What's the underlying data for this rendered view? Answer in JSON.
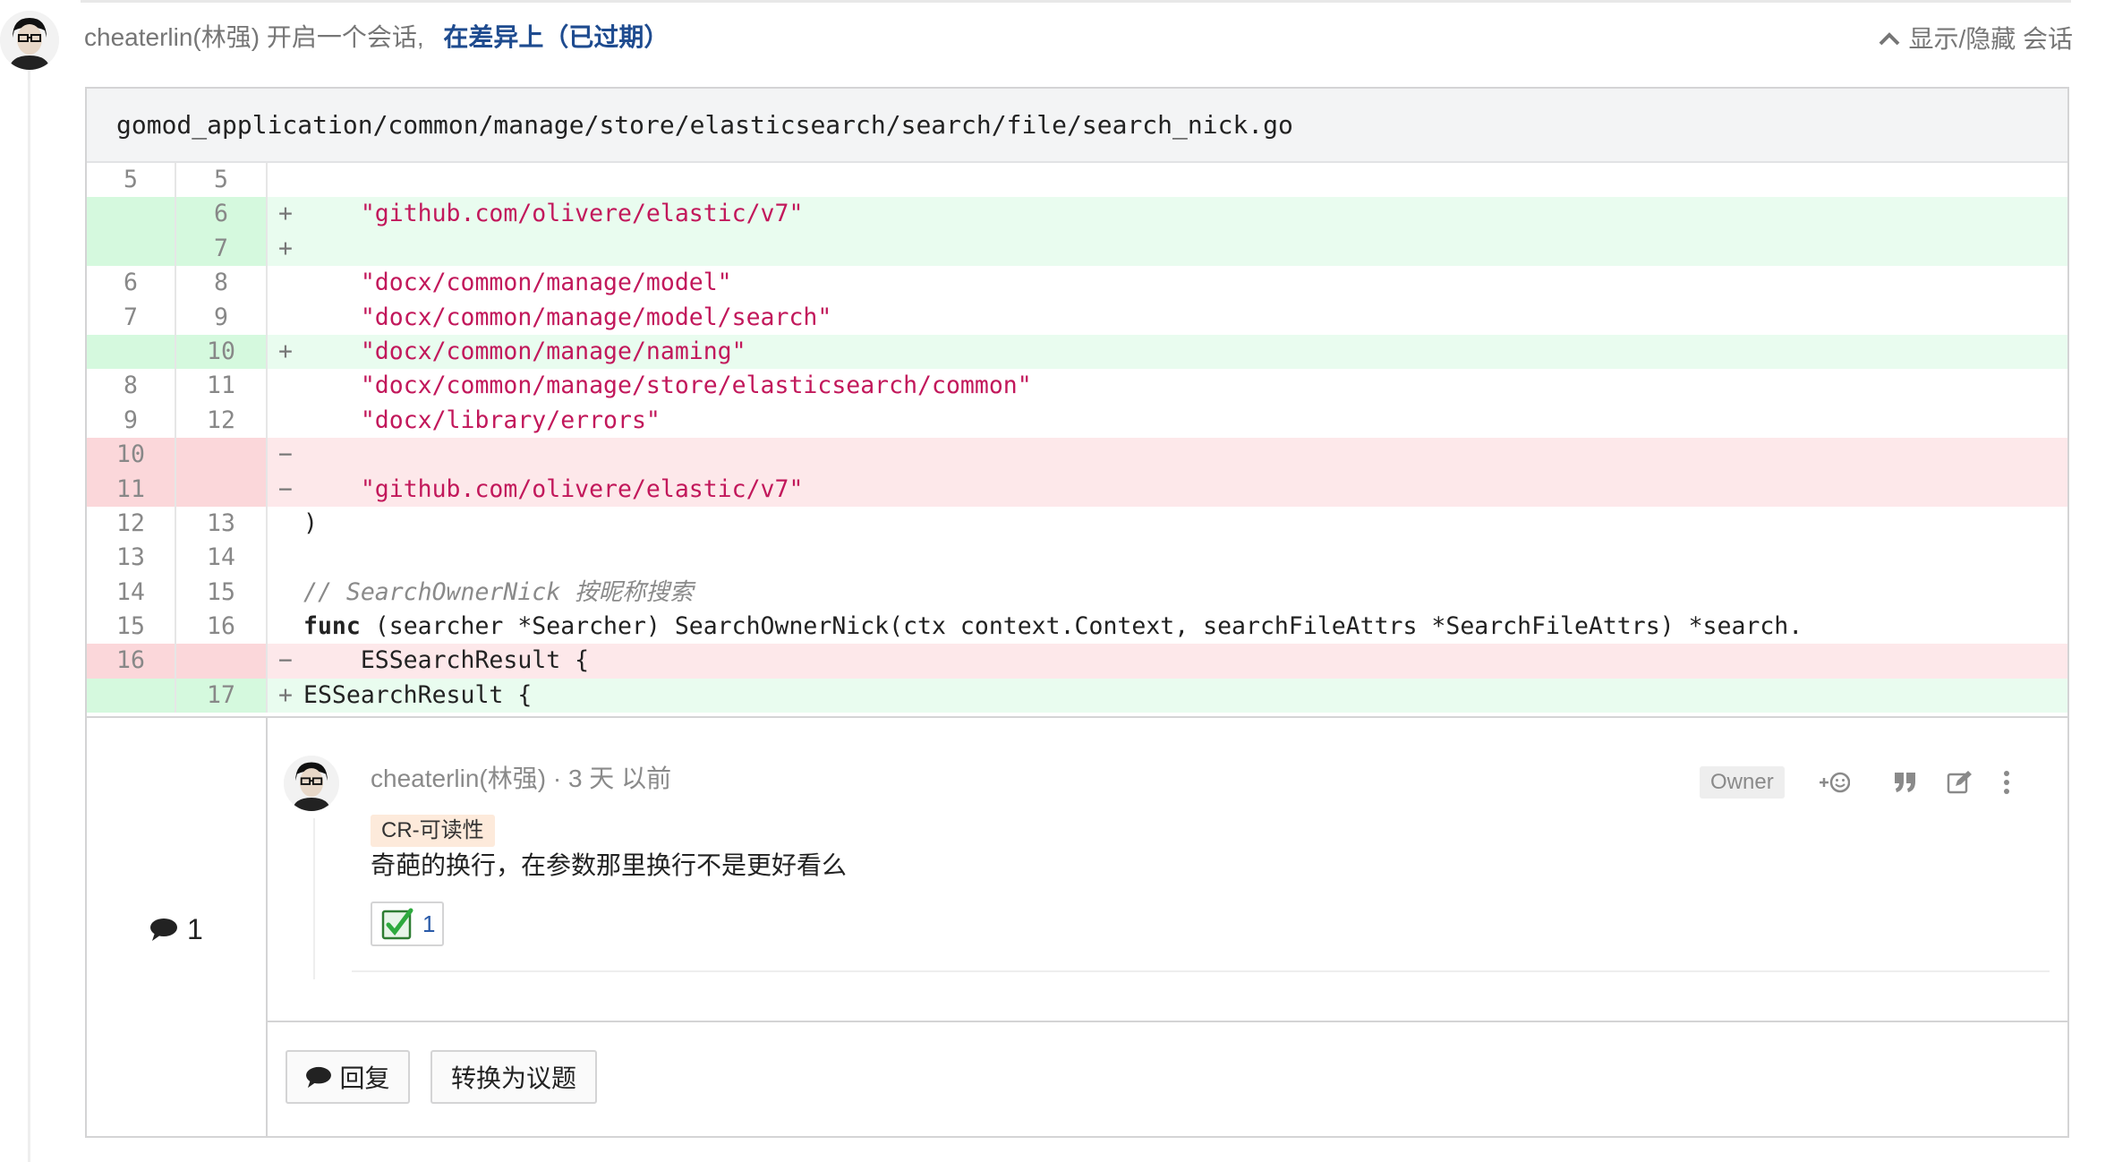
{
  "header": {
    "author": "cheaterlin(林强)",
    "action_text": "开启一个会话,",
    "context_link": "在差异上（已过期）",
    "toggle_label": "显示/隐藏 会话"
  },
  "file": {
    "path": "gomod_application/common/manage/store/elasticsearch/search/file/search_nick.go"
  },
  "diff_lines": [
    {
      "type": "ctx",
      "old": "5",
      "new": "5",
      "sign": "",
      "code": ""
    },
    {
      "type": "add",
      "old": "",
      "new": "6",
      "sign": "+",
      "code": "    \"github.com/olivere/elastic/v7\""
    },
    {
      "type": "add",
      "old": "",
      "new": "7",
      "sign": "+",
      "code": ""
    },
    {
      "type": "ctx",
      "old": "6",
      "new": "8",
      "sign": "",
      "code": "    \"docx/common/manage/model\""
    },
    {
      "type": "ctx",
      "old": "7",
      "new": "9",
      "sign": "",
      "code": "    \"docx/common/manage/model/search\""
    },
    {
      "type": "add",
      "old": "",
      "new": "10",
      "sign": "+",
      "code": "    \"docx/common/manage/naming\""
    },
    {
      "type": "ctx",
      "old": "8",
      "new": "11",
      "sign": "",
      "code": "    \"docx/common/manage/store/elasticsearch/common\""
    },
    {
      "type": "ctx",
      "old": "9",
      "new": "12",
      "sign": "",
      "code": "    \"docx/library/errors\""
    },
    {
      "type": "del",
      "old": "10",
      "new": "",
      "sign": "−",
      "code": ""
    },
    {
      "type": "del",
      "old": "11",
      "new": "",
      "sign": "−",
      "code": "    \"github.com/olivere/elastic/v7\""
    },
    {
      "type": "ctx",
      "old": "12",
      "new": "13",
      "sign": "",
      "code": ")"
    },
    {
      "type": "ctx",
      "old": "13",
      "new": "14",
      "sign": "",
      "code": ""
    },
    {
      "type": "ctx",
      "old": "14",
      "new": "15",
      "sign": "",
      "code": "// SearchOwnerNick 按昵称搜索"
    },
    {
      "type": "ctx",
      "old": "15",
      "new": "16",
      "sign": "",
      "code": "func (searcher *Searcher) SearchOwnerNick(ctx context.Context, searchFileAttrs *SearchFileAttrs) *search."
    },
    {
      "type": "del",
      "old": "16",
      "new": "",
      "sign": "−",
      "code": "    ESSearchResult {"
    },
    {
      "type": "add",
      "old": "",
      "new": "17",
      "sign": "+",
      "code": "ESSearchResult {"
    }
  ],
  "comment": {
    "count": "1",
    "author": "cheaterlin(林强)",
    "separator": "·",
    "time": "3 天 以前",
    "role_badge": "Owner",
    "react_label": "+☺",
    "label_tag": "CR-可读性",
    "body": "奇葩的换行，在参数那里换行不是更好看么",
    "reaction_count": "1"
  },
  "buttons": {
    "reply": "回复",
    "convert": "转换为议题"
  },
  "colors": {
    "link": "#1e4b8f",
    "string": "#c2185b",
    "add_bg": "#e9fcef",
    "del_bg": "#fde8ea",
    "label_bg": "#fdeadb"
  }
}
